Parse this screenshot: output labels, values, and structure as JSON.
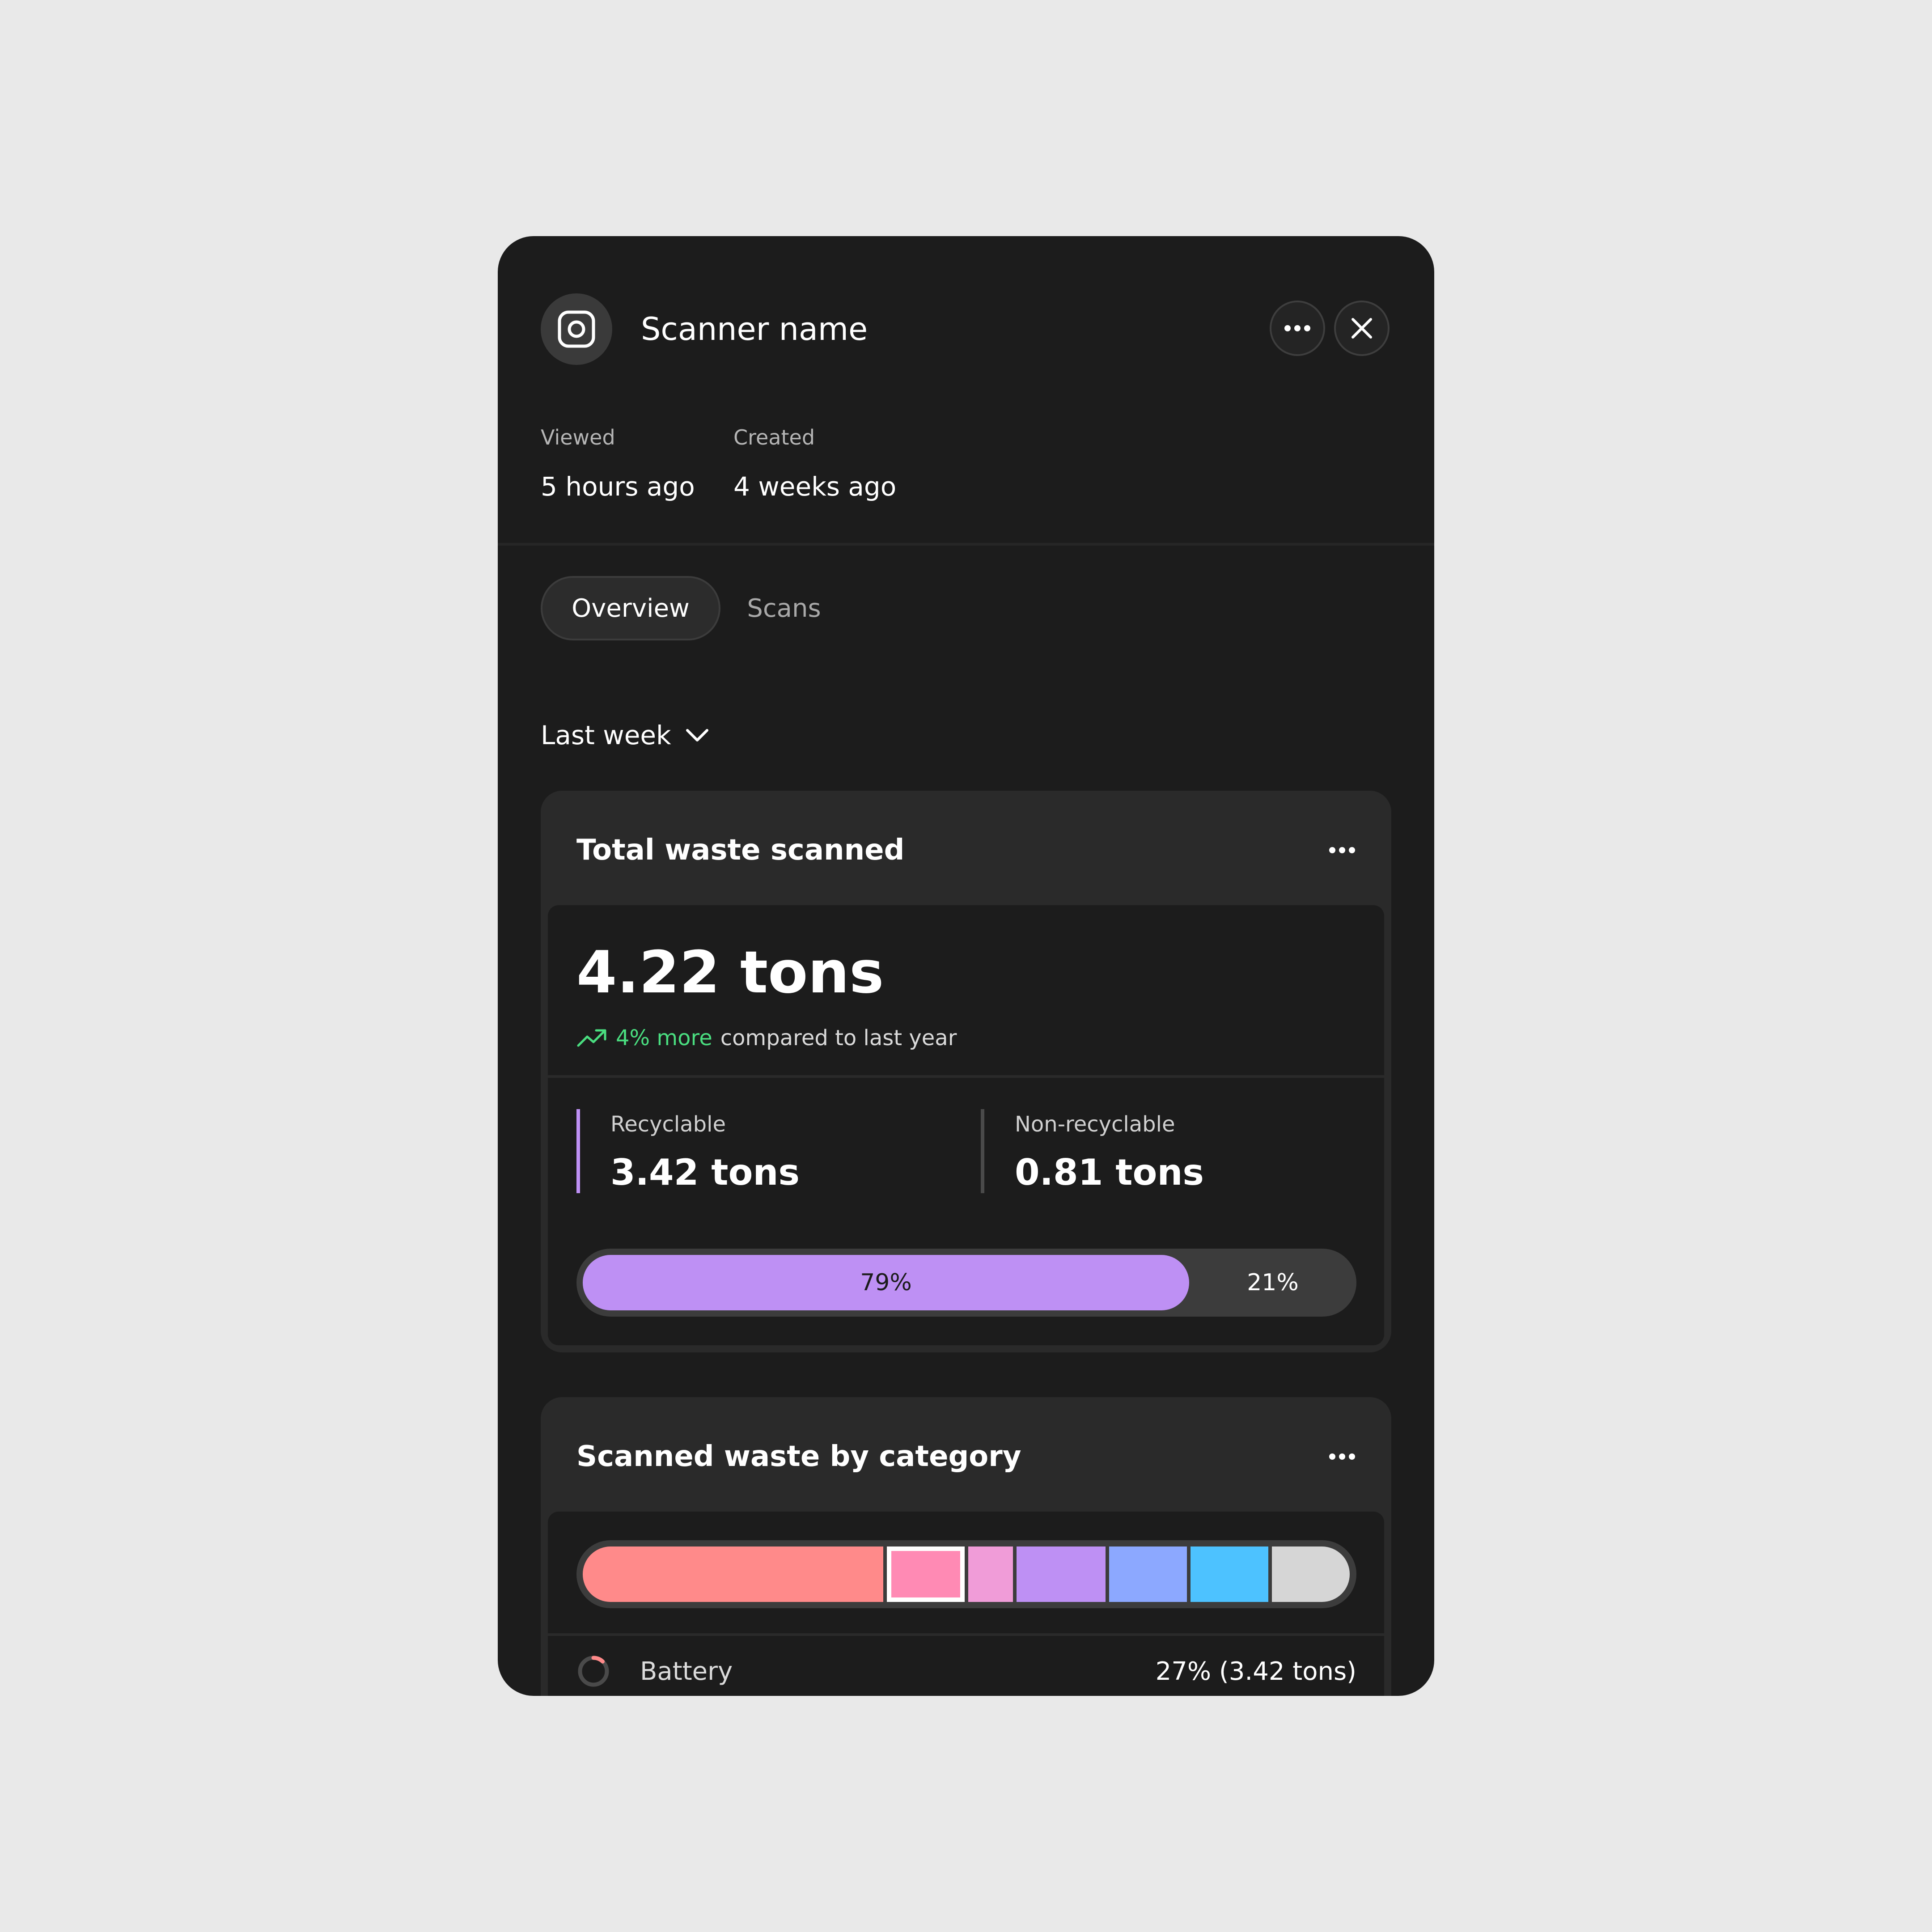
{
  "panel": {
    "title": "Scanner name",
    "icon": "camera-square-icon",
    "actions": {
      "more_icon": "more-horizontal-icon",
      "close_icon": "close-icon"
    }
  },
  "meta": {
    "viewed_label": "Viewed",
    "viewed_value": "5 hours ago",
    "created_label": "Created",
    "created_value": "4 weeks ago"
  },
  "tabs": [
    {
      "label": "Overview",
      "active": true
    },
    {
      "label": "Scans",
      "active": false
    }
  ],
  "range_select": {
    "value": "Last week",
    "icon": "chevron-down-icon"
  },
  "total_card": {
    "title": "Total waste scanned",
    "value": "4.22 tons",
    "trend_highlight": "4% more",
    "trend_rest": "compared to last year",
    "trend_icon": "trend-up-icon",
    "trend_color": "#4ADE80",
    "recyclable_label": "Recyclable",
    "recyclable_value": "3.42 tons",
    "nonrecyclable_label": "Non-recyclable",
    "nonrecyclable_value": "0.81 tons",
    "recyclable_pct": 79,
    "recyclable_pct_label": "79%",
    "nonrecyclable_pct_label": "21%",
    "accent": "#BE90F4"
  },
  "category_card": {
    "title": "Scanned waste by category",
    "segments": [
      {
        "share": 27,
        "color": "#FF8A8A",
        "selected": false
      },
      {
        "share": 7,
        "color": "#FF8AB4",
        "selected": true
      },
      {
        "share": 4,
        "color": "#F09CD8",
        "selected": false
      },
      {
        "share": 8,
        "color": "#BE90F4",
        "selected": false
      },
      {
        "share": 7,
        "color": "#8CA8FF",
        "selected": false
      },
      {
        "share": 7,
        "color": "#4DC2FF",
        "selected": false
      },
      {
        "share": 7,
        "color": "#D6D6D6",
        "selected": false
      }
    ],
    "rows": [
      {
        "name": "Battery",
        "value": "27% (3.42 tons)",
        "share": 0.27,
        "color": "#FF8A8A"
      }
    ]
  }
}
